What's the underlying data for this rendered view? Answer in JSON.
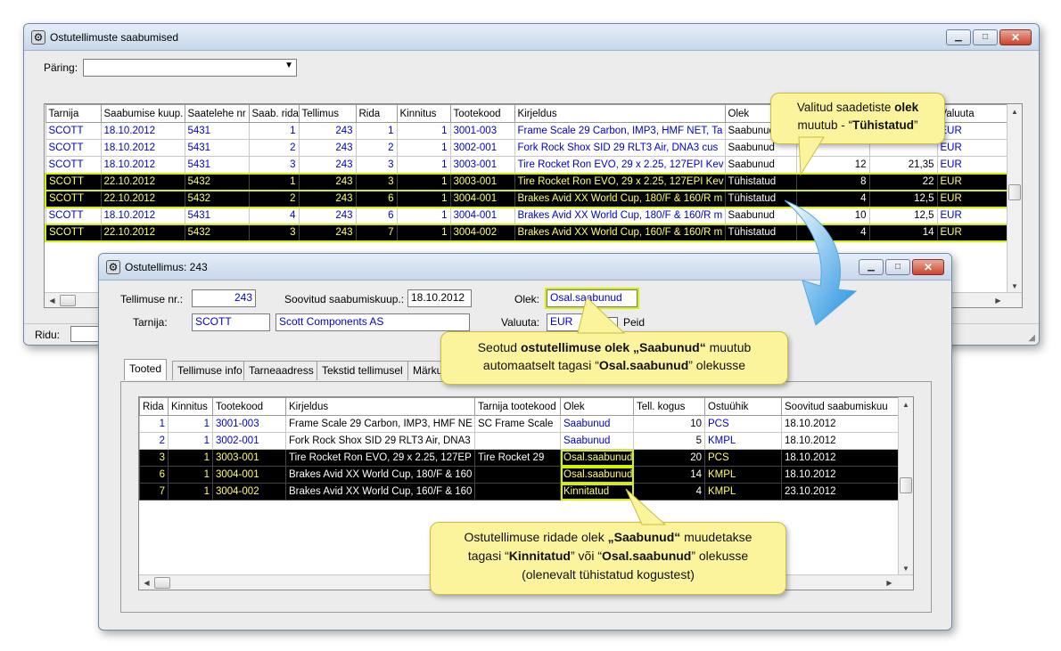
{
  "main_window": {
    "title": "Ostutellimuste saabumised",
    "query_label": "Päring:",
    "query_value": "",
    "rows_label": "Ridu:",
    "columns": [
      "Tarnija",
      "Saabumise kuup.",
      "Saatelehe nr",
      "Saab. rida",
      "Tellimus",
      "Rida",
      "Kinnitus",
      "Tootekood",
      "Kirjeldus",
      "Olek",
      "",
      "",
      "Valuuta"
    ],
    "rows": [
      {
        "tarnija": "SCOTT",
        "kuup": "18.10.2012",
        "saateleht": "5431",
        "saab_rida": "1",
        "tellimus": "243",
        "rida": "1",
        "kinnitus": "1",
        "tootekood": "3001-003",
        "kirjeldus": "Frame Scale 29 Carbon, IMP3, HMF NET, Ta",
        "olek": "Saabunud",
        "kogus": "",
        "hind": "",
        "valuuta": "EUR",
        "dark": false
      },
      {
        "tarnija": "SCOTT",
        "kuup": "18.10.2012",
        "saateleht": "5431",
        "saab_rida": "2",
        "tellimus": "243",
        "rida": "2",
        "kinnitus": "1",
        "tootekood": "3002-001",
        "kirjeldus": "Fork Rock Shox SID 29 RLT3 Air, DNA3 cus",
        "olek": "Saabunud",
        "kogus": "",
        "hind": "",
        "valuuta": "EUR",
        "dark": false
      },
      {
        "tarnija": "SCOTT",
        "kuup": "18.10.2012",
        "saateleht": "5431",
        "saab_rida": "3",
        "tellimus": "243",
        "rida": "3",
        "kinnitus": "1",
        "tootekood": "3003-001",
        "kirjeldus": "Tire Rocket Ron EVO, 29 x 2.25, 127EPI Kev",
        "olek": "Saabunud",
        "kogus": "12",
        "hind": "21,35",
        "valuuta": "EUR",
        "dark": false
      },
      {
        "tarnija": "SCOTT",
        "kuup": "22.10.2012",
        "saateleht": "5432",
        "saab_rida": "1",
        "tellimus": "243",
        "rida": "3",
        "kinnitus": "1",
        "tootekood": "3003-001",
        "kirjeldus": "Tire Rocket Ron EVO, 29 x 2.25, 127EPI Kev",
        "olek": "Tühistatud",
        "kogus": "8",
        "hind": "22",
        "valuuta": "EUR",
        "dark": true
      },
      {
        "tarnija": "SCOTT",
        "kuup": "22.10.2012",
        "saateleht": "5432",
        "saab_rida": "2",
        "tellimus": "243",
        "rida": "6",
        "kinnitus": "1",
        "tootekood": "3004-001",
        "kirjeldus": "Brakes Avid XX World Cup, 180/F & 160/R m",
        "olek": "Tühistatud",
        "kogus": "4",
        "hind": "12,5",
        "valuuta": "EUR",
        "dark": true
      },
      {
        "tarnija": "SCOTT",
        "kuup": "18.10.2012",
        "saateleht": "5431",
        "saab_rida": "4",
        "tellimus": "243",
        "rida": "6",
        "kinnitus": "1",
        "tootekood": "3004-001",
        "kirjeldus": "Brakes Avid XX World Cup, 180/F & 160/R m",
        "olek": "Saabunud",
        "kogus": "10",
        "hind": "12,5",
        "valuuta": "EUR",
        "dark": false
      },
      {
        "tarnija": "SCOTT",
        "kuup": "22.10.2012",
        "saateleht": "5432",
        "saab_rida": "3",
        "tellimus": "243",
        "rida": "7",
        "kinnitus": "1",
        "tootekood": "3004-002",
        "kirjeldus": "Brakes Avid XX World Cup, 160/F & 160/R m",
        "olek": "Tühistatud",
        "kogus": "4",
        "hind": "14",
        "valuuta": "EUR",
        "dark": true
      }
    ]
  },
  "order_window": {
    "title": "Ostutellimus: 243",
    "order_nr_label": "Tellimuse nr.:",
    "order_nr": "243",
    "desired_date_label": "Soovitud saabumiskuup.:",
    "desired_date": "18.10.2012",
    "status_label": "Olek:",
    "status": "Osal.saabunud",
    "supplier_label": "Tarnija:",
    "supplier_code": "SCOTT",
    "supplier_name": "Scott Components AS",
    "currency_label": "Valuuta:",
    "currency": "EUR",
    "hide_label": "Peid",
    "tabs": [
      "Tooted",
      "Tellimuse info",
      "Tarneaadress",
      "Tekstid tellimusel",
      "Märku"
    ],
    "columns": [
      "Rida",
      "Kinnitus",
      "Tootekood",
      "Kirjeldus",
      "Tarnija tootekood",
      "Olek",
      "Tell. kogus",
      "Ostuühik",
      "Soovitud saabumiskuu"
    ],
    "rows": [
      {
        "rida": "1",
        "kinnitus": "1",
        "tootekood": "3001-003",
        "kirjeldus": "Frame Scale 29 Carbon, IMP3, HMF NE",
        "tarnija_kood": "SC Frame Scale",
        "olek": "Saabunud",
        "kogus": "10",
        "uhik": "PCS",
        "kuup": "18.10.2012",
        "dark": false
      },
      {
        "rida": "2",
        "kinnitus": "1",
        "tootekood": "3002-001",
        "kirjeldus": "Fork Rock Shox SID 29 RLT3 Air, DNA3",
        "tarnija_kood": "",
        "olek": "Saabunud",
        "kogus": "5",
        "uhik": "KMPL",
        "kuup": "18.10.2012",
        "dark": false
      },
      {
        "rida": "3",
        "kinnitus": "1",
        "tootekood": "3003-001",
        "kirjeldus": "Tire Rocket Ron EVO, 29 x 2.25, 127EP",
        "tarnija_kood": "Tire Rocket 29",
        "olek": "Osal.saabunud",
        "kogus": "20",
        "uhik": "PCS",
        "kuup": "18.10.2012",
        "dark": true
      },
      {
        "rida": "6",
        "kinnitus": "1",
        "tootekood": "3004-001",
        "kirjeldus": "Brakes Avid XX World Cup, 180/F & 160",
        "tarnija_kood": "",
        "olek": "Osal.saabunud",
        "kogus": "14",
        "uhik": "KMPL",
        "kuup": "18.10.2012",
        "dark": true
      },
      {
        "rida": "7",
        "kinnitus": "1",
        "tootekood": "3004-002",
        "kirjeldus": "Brakes Avid XX World Cup, 160/F & 160",
        "tarnija_kood": "",
        "olek": "Kinnitatud",
        "kogus": "4",
        "uhik": "KMPL",
        "kuup": "23.10.2012",
        "dark": true
      }
    ]
  },
  "callouts": {
    "c1_line1_a": "Valitud saadetiste ",
    "c1_line1_b": "olek",
    "c1_line2_a": "muutub - “",
    "c1_line2_b": "Tühistatud",
    "c1_line2_c": "”",
    "c2_line1_a": "Seotud ",
    "c2_line1_b": "ostutellimuse olek „Saabunud“",
    "c2_line1_c": " muutub",
    "c2_line2_a": "automaatselt tagasi “",
    "c2_line2_b": "Osal.saabunud",
    "c2_line2_c": "” olekusse",
    "c3_line1_a": "Ostutellimuse ridade olek ",
    "c3_line1_b": "„Saabunud“",
    "c3_line1_c": " muudetakse",
    "c3_line2_a": "tagasi  “",
    "c3_line2_b": "Kinnitatud",
    "c3_line2_c": "” või “",
    "c3_line2_d": "Osal.saabunud",
    "c3_line2_e": "”  olekusse",
    "c3_line3": "(olenevalt tühistatud kogustest)"
  },
  "colors": {
    "highlight": "#d4f000",
    "callout_bg": "#fbf49c",
    "arrow": "#2aa3e8"
  }
}
